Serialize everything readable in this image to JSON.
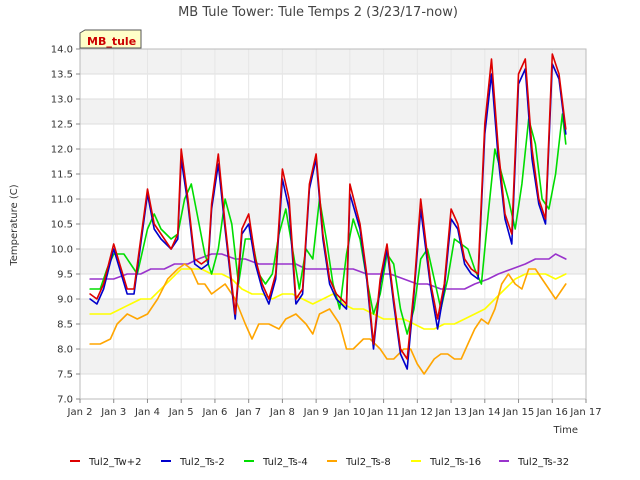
{
  "chart_data": {
    "type": "line",
    "title": "MB Tule Tower: Tule Temps 2 (3/23/17-now)",
    "xlabel": "Time",
    "ylabel": "Temperature (C)",
    "site_badge": "MB_tule",
    "xlim": [
      2,
      17
    ],
    "ylim": [
      7.0,
      14.0
    ],
    "x_ticks": [
      {
        "value": 2,
        "label": "Jan 2"
      },
      {
        "value": 3,
        "label": "Jan 3"
      },
      {
        "value": 4,
        "label": "Jan 4"
      },
      {
        "value": 5,
        "label": "Jan 5"
      },
      {
        "value": 6,
        "label": "Jan 6"
      },
      {
        "value": 7,
        "label": "Jan 7"
      },
      {
        "value": 8,
        "label": "Jan 8"
      },
      {
        "value": 9,
        "label": "Jan 9"
      },
      {
        "value": 10,
        "label": "Jan 10"
      },
      {
        "value": 11,
        "label": "Jan 11"
      },
      {
        "value": 12,
        "label": "Jan 12"
      },
      {
        "value": 13,
        "label": "Jan 13"
      },
      {
        "value": 14,
        "label": "Jan 14"
      },
      {
        "value": 15,
        "label": "Jan 15"
      },
      {
        "value": 16,
        "label": "Jan 16"
      },
      {
        "value": 17,
        "label": "Jan 17"
      }
    ],
    "y_ticks": [
      {
        "value": 7.0,
        "label": "7.0"
      },
      {
        "value": 7.5,
        "label": "7.5"
      },
      {
        "value": 8.0,
        "label": "8.0"
      },
      {
        "value": 8.5,
        "label": "8.5"
      },
      {
        "value": 9.0,
        "label": "9.0"
      },
      {
        "value": 9.5,
        "label": "9.5"
      },
      {
        "value": 10.0,
        "label": "10.0"
      },
      {
        "value": 10.5,
        "label": "10.5"
      },
      {
        "value": 11.0,
        "label": "11.0"
      },
      {
        "value": 11.5,
        "label": "11.5"
      },
      {
        "value": 12.0,
        "label": "12.0"
      },
      {
        "value": 12.5,
        "label": "12.5"
      },
      {
        "value": 13.0,
        "label": "13.0"
      },
      {
        "value": 13.5,
        "label": "13.5"
      },
      {
        "value": 14.0,
        "label": "14.0"
      }
    ],
    "grid": true,
    "legend_position": "bottom",
    "series": [
      {
        "name": "Tul2_Tw+2",
        "color": "#dd0000",
        "x": [
          2.3,
          2.5,
          2.7,
          3.0,
          3.4,
          3.6,
          4.0,
          4.2,
          4.4,
          4.7,
          4.9,
          5.0,
          5.2,
          5.4,
          5.6,
          5.8,
          5.9,
          6.1,
          6.3,
          6.6,
          6.8,
          7.0,
          7.2,
          7.4,
          7.6,
          7.8,
          8.0,
          8.2,
          8.4,
          8.6,
          8.8,
          9.0,
          9.2,
          9.4,
          9.6,
          9.9,
          10.0,
          10.3,
          10.5,
          10.7,
          10.9,
          11.1,
          11.3,
          11.5,
          11.7,
          11.9,
          12.1,
          12.4,
          12.6,
          12.8,
          13.0,
          13.2,
          13.4,
          13.6,
          13.8,
          14.0,
          14.2,
          14.4,
          14.6,
          14.8,
          15.0,
          15.2,
          15.4,
          15.6,
          15.8,
          16.0,
          16.2,
          16.4
        ],
        "y": [
          9.1,
          9.0,
          9.3,
          10.1,
          9.2,
          9.2,
          11.2,
          10.5,
          10.3,
          10.0,
          10.3,
          12.0,
          11.0,
          9.8,
          9.7,
          9.8,
          10.9,
          11.9,
          10.5,
          8.7,
          10.4,
          10.7,
          9.8,
          9.3,
          9.0,
          9.5,
          11.6,
          11.0,
          9.0,
          9.2,
          11.3,
          11.9,
          10.3,
          9.4,
          9.1,
          8.9,
          11.3,
          10.5,
          9.5,
          8.1,
          9.4,
          10.1,
          9.0,
          8.0,
          7.8,
          9.2,
          11.0,
          9.3,
          8.6,
          9.3,
          10.8,
          10.5,
          9.8,
          9.6,
          9.5,
          12.5,
          13.8,
          12.0,
          10.7,
          10.3,
          13.5,
          13.8,
          12.0,
          11.0,
          10.6,
          13.9,
          13.5,
          12.4
        ]
      },
      {
        "name": "Tul2_Ts-2",
        "color": "#0000cc",
        "x": [
          2.3,
          2.5,
          2.7,
          3.0,
          3.4,
          3.6,
          4.0,
          4.2,
          4.4,
          4.7,
          4.9,
          5.0,
          5.2,
          5.4,
          5.6,
          5.8,
          5.9,
          6.1,
          6.3,
          6.6,
          6.8,
          7.0,
          7.2,
          7.4,
          7.6,
          7.8,
          8.0,
          8.2,
          8.4,
          8.6,
          8.8,
          9.0,
          9.2,
          9.4,
          9.6,
          9.9,
          10.0,
          10.3,
          10.5,
          10.7,
          10.9,
          11.1,
          11.3,
          11.5,
          11.7,
          11.9,
          12.1,
          12.4,
          12.6,
          12.8,
          13.0,
          13.2,
          13.4,
          13.6,
          13.8,
          14.0,
          14.2,
          14.4,
          14.6,
          14.8,
          15.0,
          15.2,
          15.4,
          15.6,
          15.8,
          16.0,
          16.2,
          16.4
        ],
        "y": [
          9.0,
          8.9,
          9.2,
          10.0,
          9.1,
          9.1,
          11.1,
          10.4,
          10.2,
          10.0,
          10.2,
          11.8,
          10.9,
          9.7,
          9.6,
          9.7,
          10.8,
          11.7,
          10.4,
          8.6,
          10.3,
          10.5,
          9.7,
          9.2,
          8.9,
          9.4,
          11.4,
          10.8,
          8.9,
          9.1,
          11.2,
          11.8,
          10.2,
          9.3,
          9.0,
          8.8,
          11.1,
          10.4,
          9.4,
          8.0,
          9.3,
          10.0,
          8.9,
          7.9,
          7.6,
          9.1,
          10.8,
          9.2,
          8.4,
          9.2,
          10.6,
          10.4,
          9.7,
          9.5,
          9.4,
          12.3,
          13.5,
          11.8,
          10.6,
          10.1,
          13.3,
          13.6,
          11.8,
          10.9,
          10.5,
          13.7,
          13.4,
          12.3
        ]
      },
      {
        "name": "Tul2_Ts-4",
        "color": "#00dd00",
        "x": [
          2.3,
          2.6,
          2.8,
          3.0,
          3.3,
          3.5,
          3.7,
          4.0,
          4.2,
          4.4,
          4.7,
          4.9,
          5.1,
          5.3,
          5.5,
          5.7,
          5.9,
          6.1,
          6.3,
          6.5,
          6.7,
          6.9,
          7.1,
          7.3,
          7.5,
          7.7,
          7.9,
          8.1,
          8.3,
          8.5,
          8.7,
          8.9,
          9.1,
          9.3,
          9.5,
          9.7,
          9.9,
          10.1,
          10.3,
          10.5,
          10.7,
          10.9,
          11.1,
          11.3,
          11.5,
          11.7,
          11.9,
          12.1,
          12.3,
          12.5,
          12.7,
          12.9,
          13.1,
          13.3,
          13.5,
          13.7,
          13.9,
          14.1,
          14.3,
          14.5,
          14.7,
          14.9,
          15.1,
          15.3,
          15.5,
          15.7,
          15.9,
          16.1,
          16.3,
          16.4
        ],
        "y": [
          9.2,
          9.2,
          9.6,
          9.9,
          9.9,
          9.7,
          9.5,
          10.4,
          10.7,
          10.4,
          10.2,
          10.3,
          11.0,
          11.3,
          10.6,
          9.9,
          9.5,
          10.0,
          11.0,
          10.5,
          9.3,
          10.2,
          10.2,
          9.5,
          9.3,
          9.5,
          10.3,
          10.8,
          10.0,
          9.2,
          10.0,
          9.8,
          11.0,
          10.2,
          9.3,
          8.8,
          9.9,
          10.6,
          10.2,
          9.4,
          8.7,
          9.1,
          9.9,
          9.7,
          8.8,
          8.3,
          8.8,
          9.8,
          10.0,
          9.4,
          8.8,
          9.4,
          10.2,
          10.1,
          10.0,
          9.6,
          9.3,
          10.7,
          12.0,
          11.5,
          11.0,
          10.4,
          11.3,
          12.6,
          12.1,
          11.0,
          10.8,
          11.5,
          12.7,
          12.1
        ]
      },
      {
        "name": "Tul2_Ts-8",
        "color": "#ffa500",
        "x": [
          2.3,
          2.6,
          2.9,
          3.1,
          3.4,
          3.7,
          4.0,
          4.3,
          4.6,
          4.9,
          5.1,
          5.3,
          5.5,
          5.7,
          5.9,
          6.1,
          6.3,
          6.6,
          6.9,
          7.1,
          7.3,
          7.6,
          7.9,
          8.1,
          8.4,
          8.7,
          8.9,
          9.1,
          9.4,
          9.7,
          9.9,
          10.1,
          10.4,
          10.6,
          10.9,
          11.1,
          11.3,
          11.6,
          11.8,
          12.0,
          12.2,
          12.5,
          12.7,
          12.9,
          13.1,
          13.3,
          13.5,
          13.7,
          13.9,
          14.1,
          14.3,
          14.5,
          14.7,
          14.9,
          15.1,
          15.3,
          15.5,
          15.7,
          15.9,
          16.1,
          16.4
        ],
        "y": [
          8.1,
          8.1,
          8.2,
          8.5,
          8.7,
          8.6,
          8.7,
          9.0,
          9.4,
          9.6,
          9.7,
          9.6,
          9.3,
          9.3,
          9.1,
          9.2,
          9.3,
          9.0,
          8.5,
          8.2,
          8.5,
          8.5,
          8.4,
          8.6,
          8.7,
          8.5,
          8.3,
          8.7,
          8.8,
          8.5,
          8.0,
          8.0,
          8.2,
          8.2,
          8.0,
          7.8,
          7.8,
          8.0,
          8.0,
          7.7,
          7.5,
          7.8,
          7.9,
          7.9,
          7.8,
          7.8,
          8.1,
          8.4,
          8.6,
          8.5,
          8.8,
          9.3,
          9.5,
          9.3,
          9.2,
          9.6,
          9.6,
          9.4,
          9.2,
          9.0,
          9.3
        ]
      },
      {
        "name": "Tul2_Ts-16",
        "color": "#ffff00",
        "x": [
          2.3,
          2.6,
          2.9,
          3.2,
          3.5,
          3.8,
          4.1,
          4.4,
          4.7,
          5.0,
          5.3,
          5.6,
          5.9,
          6.2,
          6.5,
          6.8,
          7.1,
          7.4,
          7.7,
          8.0,
          8.3,
          8.6,
          8.9,
          9.2,
          9.5,
          9.8,
          10.1,
          10.4,
          10.7,
          11.0,
          11.3,
          11.6,
          11.9,
          12.2,
          12.5,
          12.8,
          13.1,
          13.4,
          13.7,
          14.0,
          14.3,
          14.6,
          14.9,
          15.2,
          15.5,
          15.8,
          16.1,
          16.4
        ],
        "y": [
          8.7,
          8.7,
          8.7,
          8.8,
          8.9,
          9.0,
          9.0,
          9.2,
          9.4,
          9.6,
          9.6,
          9.6,
          9.5,
          9.5,
          9.4,
          9.2,
          9.1,
          9.1,
          9.0,
          9.1,
          9.1,
          9.0,
          8.9,
          9.0,
          9.1,
          8.9,
          8.8,
          8.8,
          8.7,
          8.6,
          8.6,
          8.6,
          8.5,
          8.4,
          8.4,
          8.5,
          8.5,
          8.6,
          8.7,
          8.8,
          9.0,
          9.2,
          9.4,
          9.5,
          9.5,
          9.5,
          9.4,
          9.5
        ]
      },
      {
        "name": "Tul2_Ts-32",
        "color": "#9933cc",
        "x": [
          2.3,
          2.7,
          3.0,
          3.4,
          3.8,
          4.1,
          4.5,
          4.8,
          5.2,
          5.5,
          5.9,
          6.2,
          6.6,
          6.9,
          7.3,
          7.6,
          8.0,
          8.4,
          8.7,
          9.1,
          9.4,
          9.8,
          10.1,
          10.5,
          10.9,
          11.2,
          11.6,
          12.0,
          12.3,
          12.7,
          13.0,
          13.4,
          13.7,
          14.1,
          14.4,
          14.8,
          15.2,
          15.5,
          15.9,
          16.1,
          16.4
        ],
        "y": [
          9.4,
          9.4,
          9.4,
          9.5,
          9.5,
          9.6,
          9.6,
          9.7,
          9.7,
          9.8,
          9.9,
          9.9,
          9.8,
          9.8,
          9.7,
          9.7,
          9.7,
          9.7,
          9.6,
          9.6,
          9.6,
          9.6,
          9.6,
          9.5,
          9.5,
          9.5,
          9.4,
          9.3,
          9.3,
          9.2,
          9.2,
          9.2,
          9.3,
          9.4,
          9.5,
          9.6,
          9.7,
          9.8,
          9.8,
          9.9,
          9.8
        ]
      }
    ]
  }
}
